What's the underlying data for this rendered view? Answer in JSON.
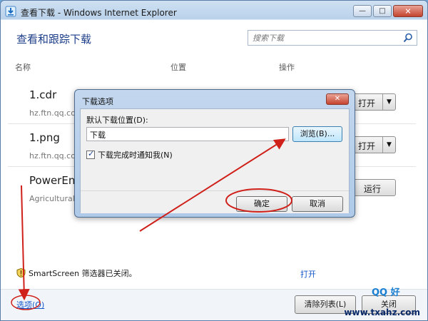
{
  "window": {
    "title": "查看下载 - Windows Internet Explorer",
    "minimize_glyph": "—",
    "maximize_glyph": "□",
    "close_glyph": "✕"
  },
  "header": {
    "title": "查看和跟踪下载",
    "search_placeholder": "搜索下载"
  },
  "columns": {
    "name": "名称",
    "location": "位置",
    "action": "操作"
  },
  "downloads": [
    {
      "name": "1.cdr",
      "source": "hz.ftn.qq.co",
      "action": "打开",
      "has_dropdown": true
    },
    {
      "name": "1.png",
      "source": "hz.ftn.qq.co",
      "action": "打开",
      "has_dropdown": true
    },
    {
      "name": "PowerEn",
      "source": "Agricultural",
      "action": "运行",
      "has_dropdown": false
    }
  ],
  "smartscreen": {
    "text": "SmartScreen 筛选器已关闭。",
    "link": "打开"
  },
  "bottom": {
    "options": "选项(O)",
    "clear_list": "清除列表(L)",
    "close": "关闭"
  },
  "dialog": {
    "title": "下载选项",
    "default_location_label": "默认下载位置(D):",
    "path_value": "下载",
    "browse": "浏览(B)...",
    "notify_label": "下载完成时通知我(N)",
    "notify_checked": true,
    "ok": "确定",
    "cancel": "取消"
  },
  "watermark": {
    "brand": "QQ 好",
    "url": "www.txahz.com"
  },
  "colors": {
    "accent_link": "#1556c9",
    "header_title": "#1e3f8a",
    "annotation_red": "#d0201a"
  }
}
